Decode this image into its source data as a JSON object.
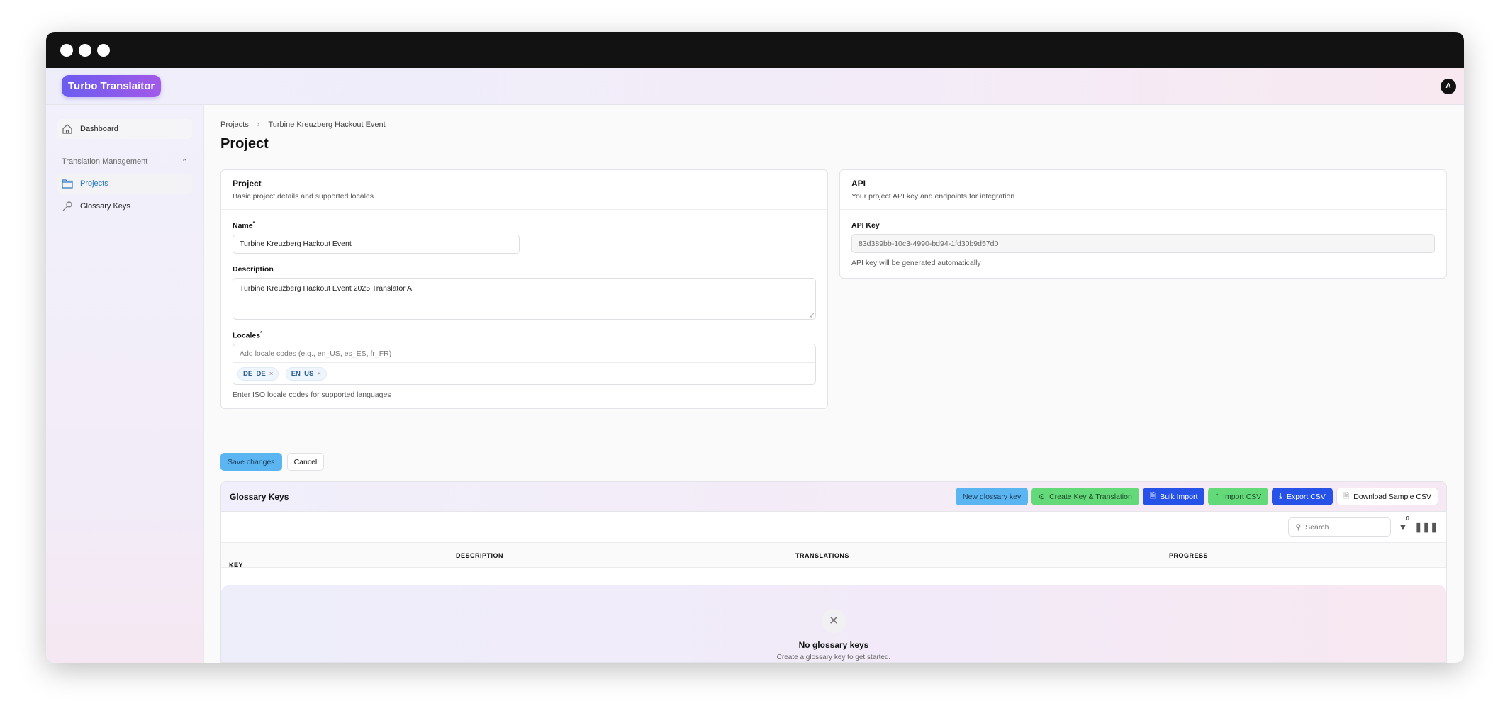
{
  "app": {
    "title": "Turbo Translaitor",
    "avatar": "A"
  },
  "sidebar": {
    "dashboard": "Dashboard",
    "group": "Translation Management",
    "items": [
      {
        "label": "Projects"
      },
      {
        "label": "Glossary Keys"
      }
    ]
  },
  "breadcrumb": [
    "Projects",
    "Turbine Kreuzberg Hackout Event"
  ],
  "page_title": "Project",
  "project_card": {
    "title": "Project",
    "subtitle": "Basic project details and supported locales",
    "name_label": "Name",
    "name_value": "Turbine Kreuzberg Hackout Event",
    "description_label": "Description",
    "description_value": "Turbine Kreuzberg Hackout Event 2025 Translator AI",
    "locales_label": "Locales",
    "locales_placeholder": "Add locale codes (e.g., en_US, es_ES, fr_FR)",
    "locales": [
      "DE_DE",
      "EN_US"
    ],
    "locales_help": "Enter ISO locale codes for supported languages"
  },
  "api_card": {
    "title": "API",
    "subtitle": "Your project API key and endpoints for integration",
    "key_label": "API Key",
    "key_value": "83d389bb-10c3-4990-bd94-1fd30b9d57d0",
    "help": "API key will be generated automatically"
  },
  "actions": {
    "save": "Save changes",
    "cancel": "Cancel"
  },
  "glossary": {
    "title": "Glossary Keys",
    "buttons": {
      "new": "New glossary key",
      "create": "Create Key & Translation",
      "bulk": "Bulk Import",
      "import": "Import CSV",
      "export": "Export CSV",
      "sample": "Download Sample CSV"
    },
    "search_placeholder": "Search",
    "filter_count": "0",
    "columns": [
      "KEY",
      "DESCRIPTION",
      "TRANSLATIONS",
      "PROGRESS"
    ],
    "empty_title": "No glossary keys",
    "empty_text": "Create a glossary key to get started."
  }
}
